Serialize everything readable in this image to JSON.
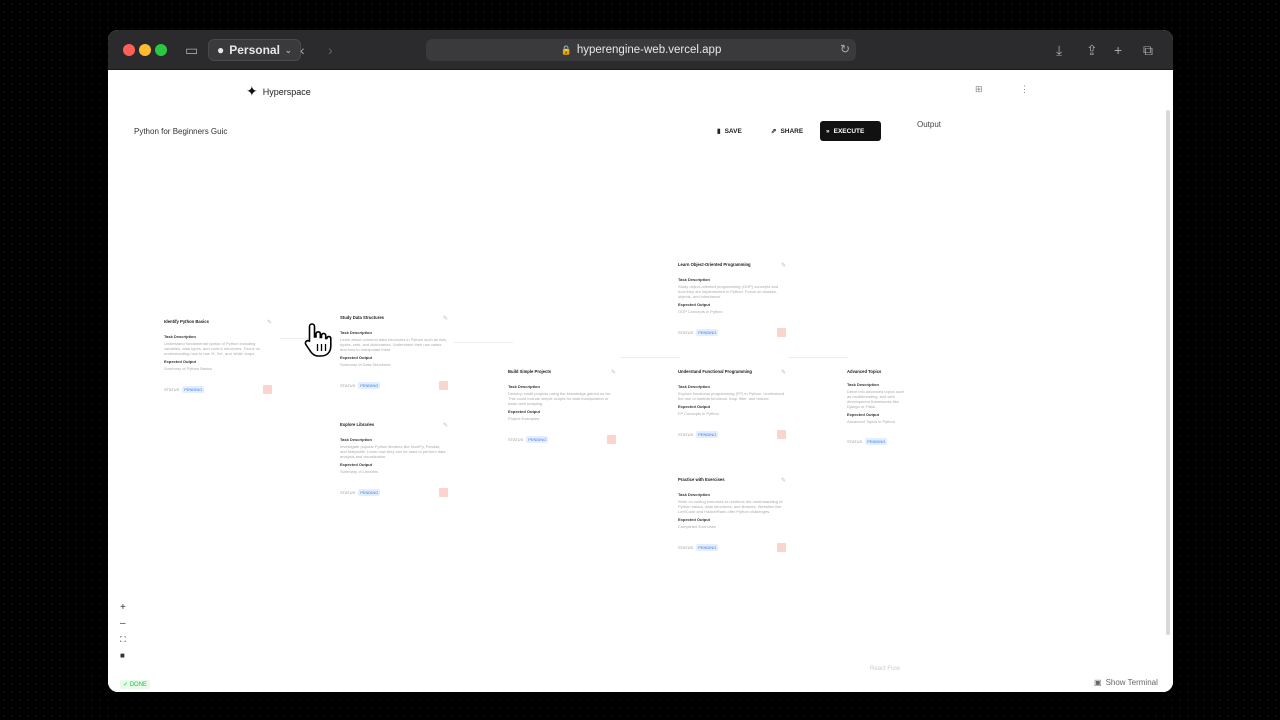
{
  "browser": {
    "profile": "Personal",
    "url": "hyperengine-web.vercel.app"
  },
  "app": {
    "logo": "Hyperspace",
    "doc_title": "Python for Beginners Guic",
    "save": "SAVE",
    "share": "SHARE",
    "execute": "EXECUTE",
    "output": "Output",
    "done": "DONE",
    "react_flow": "React Flow",
    "show_terminal": "Show Terminal"
  },
  "labels": {
    "task_description": "Task Description",
    "expected_output": "Expected Output",
    "status": "STATUS",
    "pending": "PENDING"
  },
  "nodes": [
    {
      "title": "Identify Python Basics",
      "desc": "Understand fundamental syntax of Python including variables, data types, and control structures. Focus on understanding how to use 'if', 'for', and 'while' loops.",
      "output": "Summary of Python Basics"
    },
    {
      "title": "Study Data Structures",
      "desc": "Learn about common data structures in Python such as lists, tuples, sets, and dictionaries. Understand their use cases and how to manipulate them.",
      "output": "Summary of Data Structures"
    },
    {
      "title": "Explore Libraries",
      "desc": "Investigate popular Python libraries like NumPy, Pandas, and Matplotlib. Learn how they can be used to perform data analysis and visualization.",
      "output": "Summary of Libraries"
    },
    {
      "title": "Build Simple Projects",
      "desc": "Develop small projects using the knowledge gained so far. This could include simple scripts for data manipulation or basic web scraping.",
      "output": "Project Examples"
    },
    {
      "title": "Learn Object-Oriented Programming",
      "desc": "Study object-oriented programming (OOP) concepts and how they are implemented in Python. Focus on classes, objects, and inheritance.",
      "output": "OOP Concepts in Python"
    },
    {
      "title": "Understand Functional Programming",
      "desc": "Explore functional programming (FP) in Python. Understand the use of lambda functions, map, filter, and reduce.",
      "output": "FP Concepts in Python"
    },
    {
      "title": "Practice with Exercises",
      "desc": "Work on coding exercises to reinforce the understanding of Python basics, data structures, and libraries. Websites like LeetCode and HackerRank offer Python challenges.",
      "output": "Completed Exercises"
    },
    {
      "title": "Advanced Topics",
      "desc": "Delve into advanced topics such as multithreading, and web development frameworks like Django or Flask.",
      "output": "Advanced Topics in Python"
    }
  ]
}
